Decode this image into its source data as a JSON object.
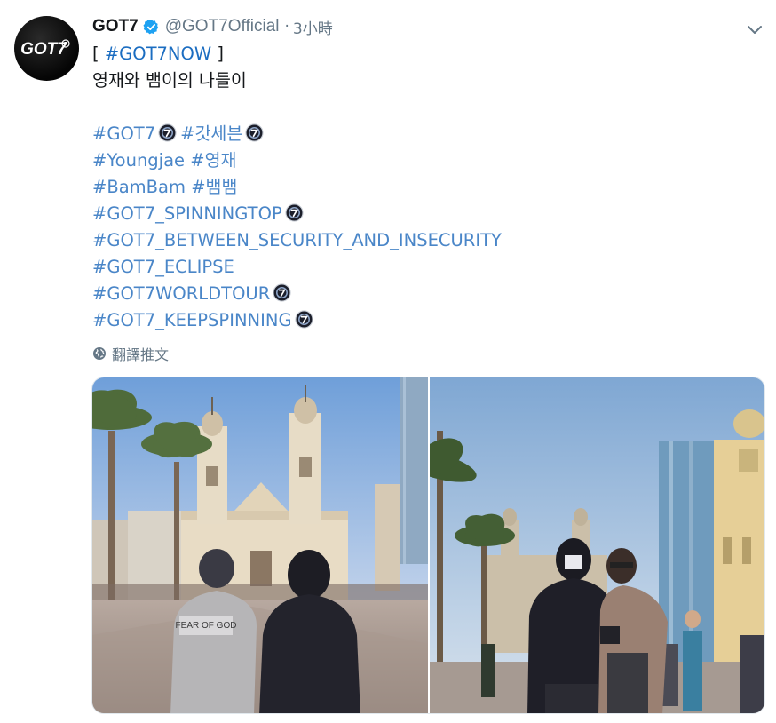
{
  "tweet": {
    "display_name": "GOT7",
    "handle": "@GOT7Official",
    "separator": "·",
    "time": "3小時",
    "lines": {
      "l1_open": "[ ",
      "l1_tag": "#GOT7NOW",
      "l1_close": " ]",
      "l2": "영재와 뱀이의 나들이",
      "l3a": "#GOT7",
      "l3b": "#갓세븐",
      "l4a": "#Youngjae",
      "l4b": "#영재",
      "l5a": "#BamBam",
      "l5b": "#뱀뱀",
      "l6": "#GOT7_SPINNINGTOP",
      "l7": "#GOT7_BETWEEN_SECURITY_AND_INSECURITY",
      "l8": "#GOT7_ECLIPSE",
      "l9": "#GOT7WORLDTOUR",
      "l10": "#GOT7_KEEPSPINNING"
    },
    "translate_label": "翻譯推文",
    "avatar_logo_text": "GOT7",
    "photo_jacket_text": "FEAR OF GOD"
  },
  "icons": {
    "verified": "verified-badge-icon",
    "caret": "chevron-down-icon",
    "globe": "globe-icon",
    "hashflag": "got7-hashflag-emoji"
  },
  "colors": {
    "hashtag": "#1b6dc1",
    "secondary_text": "#657786",
    "verified": "#1da1f2"
  }
}
